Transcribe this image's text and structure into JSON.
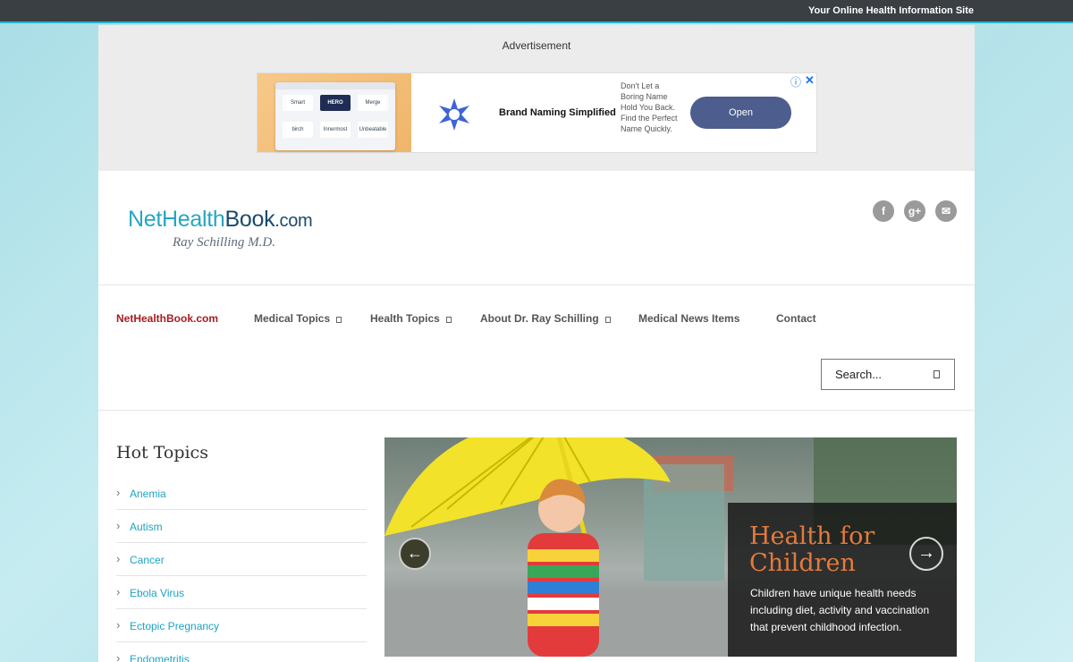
{
  "topbar": {
    "tagline": "Your Online Health Information Site"
  },
  "ad": {
    "label": "Advertisement",
    "image_tiles": [
      "Smart",
      "HERO",
      "Merge",
      "birch",
      "Innermost",
      "Unbeatable"
    ],
    "title": "Brand Naming Simplified",
    "description": "Don't Let a Boring Name Hold You Back. Find the Perfect Name Quickly.",
    "button": "Open",
    "info_icon": "ⓘ",
    "close_icon": "✕"
  },
  "logo": {
    "part1": "NetHealth",
    "part2": "Book",
    "part3": ".com",
    "subtitle": "Ray Schilling M.D."
  },
  "social": {
    "facebook": "f",
    "googleplus": "g+",
    "email": "✉"
  },
  "nav": {
    "items": [
      {
        "label": "NetHealthBook.com"
      },
      {
        "label": "Medical Topics"
      },
      {
        "label": "Health Topics"
      },
      {
        "label": "About Dr. Ray Schilling"
      },
      {
        "label": "Medical News Items"
      },
      {
        "label": "Contact"
      }
    ],
    "search_placeholder": "Search..."
  },
  "sidebar": {
    "title": "Hot Topics",
    "topics": [
      "Anemia",
      "Autism",
      "Cancer",
      "Ebola Virus",
      "Ectopic Pregnancy",
      "Endometritis"
    ]
  },
  "slider": {
    "title": "Health for Children",
    "text": "Children have unique health needs including diet, activity and vaccination that prevent childhood infection.",
    "prev": "←",
    "next": "→"
  },
  "colors": {
    "accent": "#26b6c9",
    "active_nav": "#a51d21",
    "link": "#1ea3c4",
    "caption_title": "#e57a3c"
  }
}
